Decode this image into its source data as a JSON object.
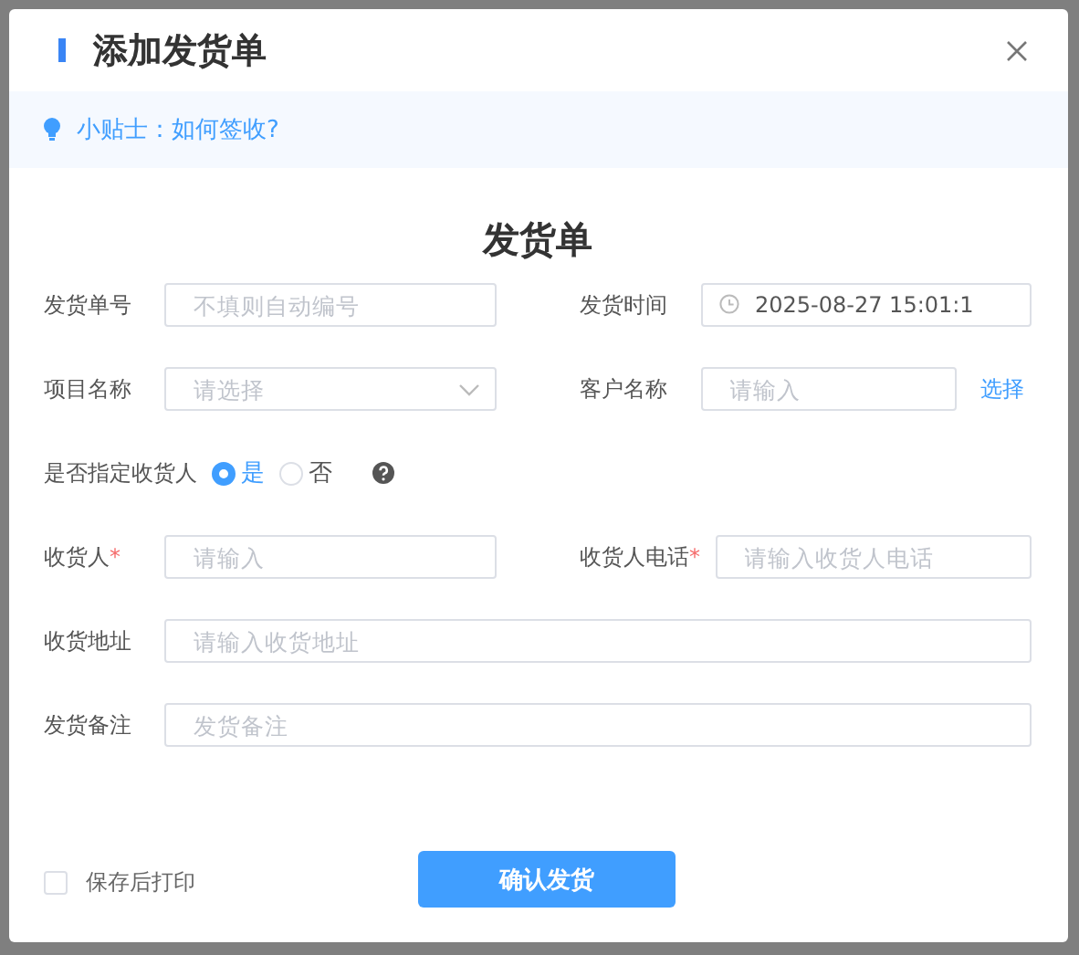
{
  "dialog": {
    "title": "添加发货单"
  },
  "tip": {
    "text": "小贴士：如何签收?"
  },
  "form": {
    "title": "发货单",
    "rows": [
      [
        {
          "kind": "input",
          "label": "发货单号",
          "placeholder": "不填则自动编号"
        },
        {
          "kind": "date",
          "label": "发货时间",
          "value": "2025-08-27 15:01:1"
        }
      ],
      [
        {
          "kind": "select",
          "label": "项目名称",
          "placeholder": "请选择"
        },
        {
          "kind": "input",
          "label": "客户名称",
          "placeholder": "请输入",
          "link": "选择"
        }
      ],
      [
        {
          "kind": "radio",
          "label": "是否指定收货人",
          "options": [
            {
              "label": "是",
              "selected": true
            },
            {
              "label": "否",
              "selected": false
            }
          ]
        }
      ],
      [
        {
          "kind": "input",
          "label": "收货人",
          "required_mark": "*",
          "placeholder": "请输入"
        },
        {
          "kind": "input",
          "label": "收货人电话",
          "required_mark": "*",
          "placeholder": "请输入收货人电话"
        }
      ],
      [
        {
          "kind": "input",
          "label": "收货地址",
          "placeholder": "请输入收货地址"
        }
      ],
      [
        {
          "kind": "input",
          "label": "发货备注",
          "placeholder": "发货备注"
        }
      ]
    ]
  },
  "footer": {
    "checkbox": {
      "label": "保存后打印",
      "checked": false
    },
    "button": "确认发货"
  }
}
